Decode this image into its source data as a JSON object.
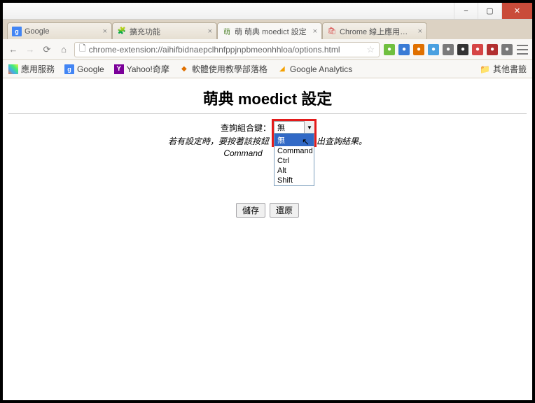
{
  "window": {
    "min_label": "−",
    "max_label": "▢",
    "close_label": "✕"
  },
  "tabs": [
    {
      "label": "Google",
      "icon": "g"
    },
    {
      "label": "擴充功能",
      "icon": "puzzle"
    },
    {
      "label": "萌 萌典 moedict 設定",
      "icon": "m",
      "active": true
    },
    {
      "label": "Chrome 線上應用程式商店",
      "icon": "store"
    }
  ],
  "nav": {
    "back": "←",
    "fwd": "→",
    "reload": "⟳",
    "home": "⌂",
    "url_icon": "🗋",
    "url": "chrome-extension://aihifbidnaepclhnfppjnpbmeonhhloa/options.html",
    "star": "☆",
    "menu": "≡"
  },
  "ext_colors": [
    "#6fbf3f",
    "#3a7bd5",
    "#e07000",
    "#4aa0e0",
    "#7a7a7a",
    "#333333",
    "#d64545",
    "#b33030",
    "#7a7a7a"
  ],
  "bookmarks": {
    "apps": "應用服務",
    "items": [
      {
        "label": "Google",
        "icon": "g"
      },
      {
        "label": "Yahoo!奇摩",
        "icon": "y"
      },
      {
        "label": "軟體使用教學部落格",
        "icon": "a"
      },
      {
        "label": "Google Analytics",
        "icon": "ga"
      }
    ],
    "other": "其他書籤"
  },
  "page": {
    "title": "萌典 moedict 設定",
    "combo_label": "查詢組合鍵：",
    "selected": "無",
    "help_left": "若有設定時，要按著該按鈕",
    "help_right": "出查詢結果。",
    "help_sub": "Command",
    "options": [
      "無",
      "Command",
      "Ctrl",
      "Alt",
      "Shift"
    ],
    "save": "儲存",
    "reset": "還原"
  }
}
